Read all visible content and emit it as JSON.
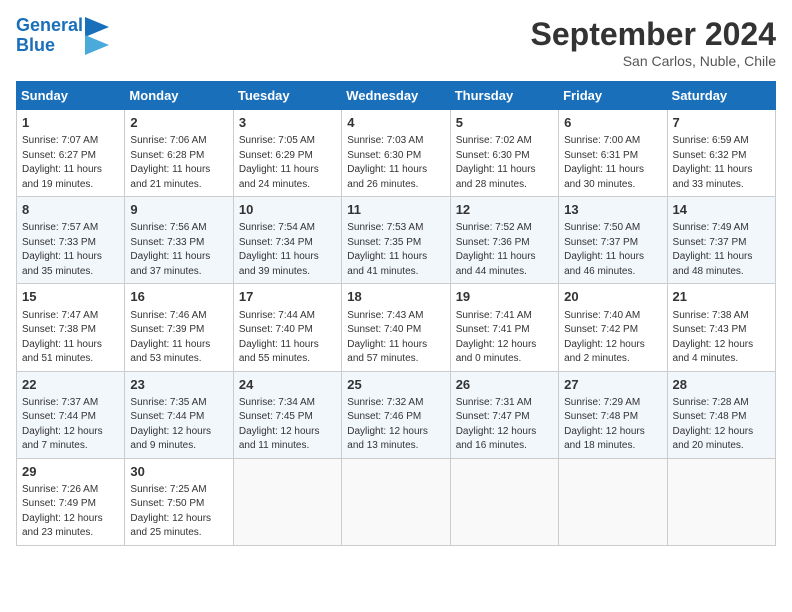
{
  "header": {
    "logo_line1": "General",
    "logo_line2": "Blue",
    "month": "September 2024",
    "location": "San Carlos, Nuble, Chile"
  },
  "weekdays": [
    "Sunday",
    "Monday",
    "Tuesday",
    "Wednesday",
    "Thursday",
    "Friday",
    "Saturday"
  ],
  "weeks": [
    [
      {
        "day": "1",
        "info": "Sunrise: 7:07 AM\nSunset: 6:27 PM\nDaylight: 11 hours\nand 19 minutes."
      },
      {
        "day": "2",
        "info": "Sunrise: 7:06 AM\nSunset: 6:28 PM\nDaylight: 11 hours\nand 21 minutes."
      },
      {
        "day": "3",
        "info": "Sunrise: 7:05 AM\nSunset: 6:29 PM\nDaylight: 11 hours\nand 24 minutes."
      },
      {
        "day": "4",
        "info": "Sunrise: 7:03 AM\nSunset: 6:30 PM\nDaylight: 11 hours\nand 26 minutes."
      },
      {
        "day": "5",
        "info": "Sunrise: 7:02 AM\nSunset: 6:30 PM\nDaylight: 11 hours\nand 28 minutes."
      },
      {
        "day": "6",
        "info": "Sunrise: 7:00 AM\nSunset: 6:31 PM\nDaylight: 11 hours\nand 30 minutes."
      },
      {
        "day": "7",
        "info": "Sunrise: 6:59 AM\nSunset: 6:32 PM\nDaylight: 11 hours\nand 33 minutes."
      }
    ],
    [
      {
        "day": "8",
        "info": "Sunrise: 7:57 AM\nSunset: 7:33 PM\nDaylight: 11 hours\nand 35 minutes."
      },
      {
        "day": "9",
        "info": "Sunrise: 7:56 AM\nSunset: 7:33 PM\nDaylight: 11 hours\nand 37 minutes."
      },
      {
        "day": "10",
        "info": "Sunrise: 7:54 AM\nSunset: 7:34 PM\nDaylight: 11 hours\nand 39 minutes."
      },
      {
        "day": "11",
        "info": "Sunrise: 7:53 AM\nSunset: 7:35 PM\nDaylight: 11 hours\nand 41 minutes."
      },
      {
        "day": "12",
        "info": "Sunrise: 7:52 AM\nSunset: 7:36 PM\nDaylight: 11 hours\nand 44 minutes."
      },
      {
        "day": "13",
        "info": "Sunrise: 7:50 AM\nSunset: 7:37 PM\nDaylight: 11 hours\nand 46 minutes."
      },
      {
        "day": "14",
        "info": "Sunrise: 7:49 AM\nSunset: 7:37 PM\nDaylight: 11 hours\nand 48 minutes."
      }
    ],
    [
      {
        "day": "15",
        "info": "Sunrise: 7:47 AM\nSunset: 7:38 PM\nDaylight: 11 hours\nand 51 minutes."
      },
      {
        "day": "16",
        "info": "Sunrise: 7:46 AM\nSunset: 7:39 PM\nDaylight: 11 hours\nand 53 minutes."
      },
      {
        "day": "17",
        "info": "Sunrise: 7:44 AM\nSunset: 7:40 PM\nDaylight: 11 hours\nand 55 minutes."
      },
      {
        "day": "18",
        "info": "Sunrise: 7:43 AM\nSunset: 7:40 PM\nDaylight: 11 hours\nand 57 minutes."
      },
      {
        "day": "19",
        "info": "Sunrise: 7:41 AM\nSunset: 7:41 PM\nDaylight: 12 hours\nand 0 minutes."
      },
      {
        "day": "20",
        "info": "Sunrise: 7:40 AM\nSunset: 7:42 PM\nDaylight: 12 hours\nand 2 minutes."
      },
      {
        "day": "21",
        "info": "Sunrise: 7:38 AM\nSunset: 7:43 PM\nDaylight: 12 hours\nand 4 minutes."
      }
    ],
    [
      {
        "day": "22",
        "info": "Sunrise: 7:37 AM\nSunset: 7:44 PM\nDaylight: 12 hours\nand 7 minutes."
      },
      {
        "day": "23",
        "info": "Sunrise: 7:35 AM\nSunset: 7:44 PM\nDaylight: 12 hours\nand 9 minutes."
      },
      {
        "day": "24",
        "info": "Sunrise: 7:34 AM\nSunset: 7:45 PM\nDaylight: 12 hours\nand 11 minutes."
      },
      {
        "day": "25",
        "info": "Sunrise: 7:32 AM\nSunset: 7:46 PM\nDaylight: 12 hours\nand 13 minutes."
      },
      {
        "day": "26",
        "info": "Sunrise: 7:31 AM\nSunset: 7:47 PM\nDaylight: 12 hours\nand 16 minutes."
      },
      {
        "day": "27",
        "info": "Sunrise: 7:29 AM\nSunset: 7:48 PM\nDaylight: 12 hours\nand 18 minutes."
      },
      {
        "day": "28",
        "info": "Sunrise: 7:28 AM\nSunset: 7:48 PM\nDaylight: 12 hours\nand 20 minutes."
      }
    ],
    [
      {
        "day": "29",
        "info": "Sunrise: 7:26 AM\nSunset: 7:49 PM\nDaylight: 12 hours\nand 23 minutes."
      },
      {
        "day": "30",
        "info": "Sunrise: 7:25 AM\nSunset: 7:50 PM\nDaylight: 12 hours\nand 25 minutes."
      },
      {
        "day": "",
        "info": ""
      },
      {
        "day": "",
        "info": ""
      },
      {
        "day": "",
        "info": ""
      },
      {
        "day": "",
        "info": ""
      },
      {
        "day": "",
        "info": ""
      }
    ]
  ]
}
